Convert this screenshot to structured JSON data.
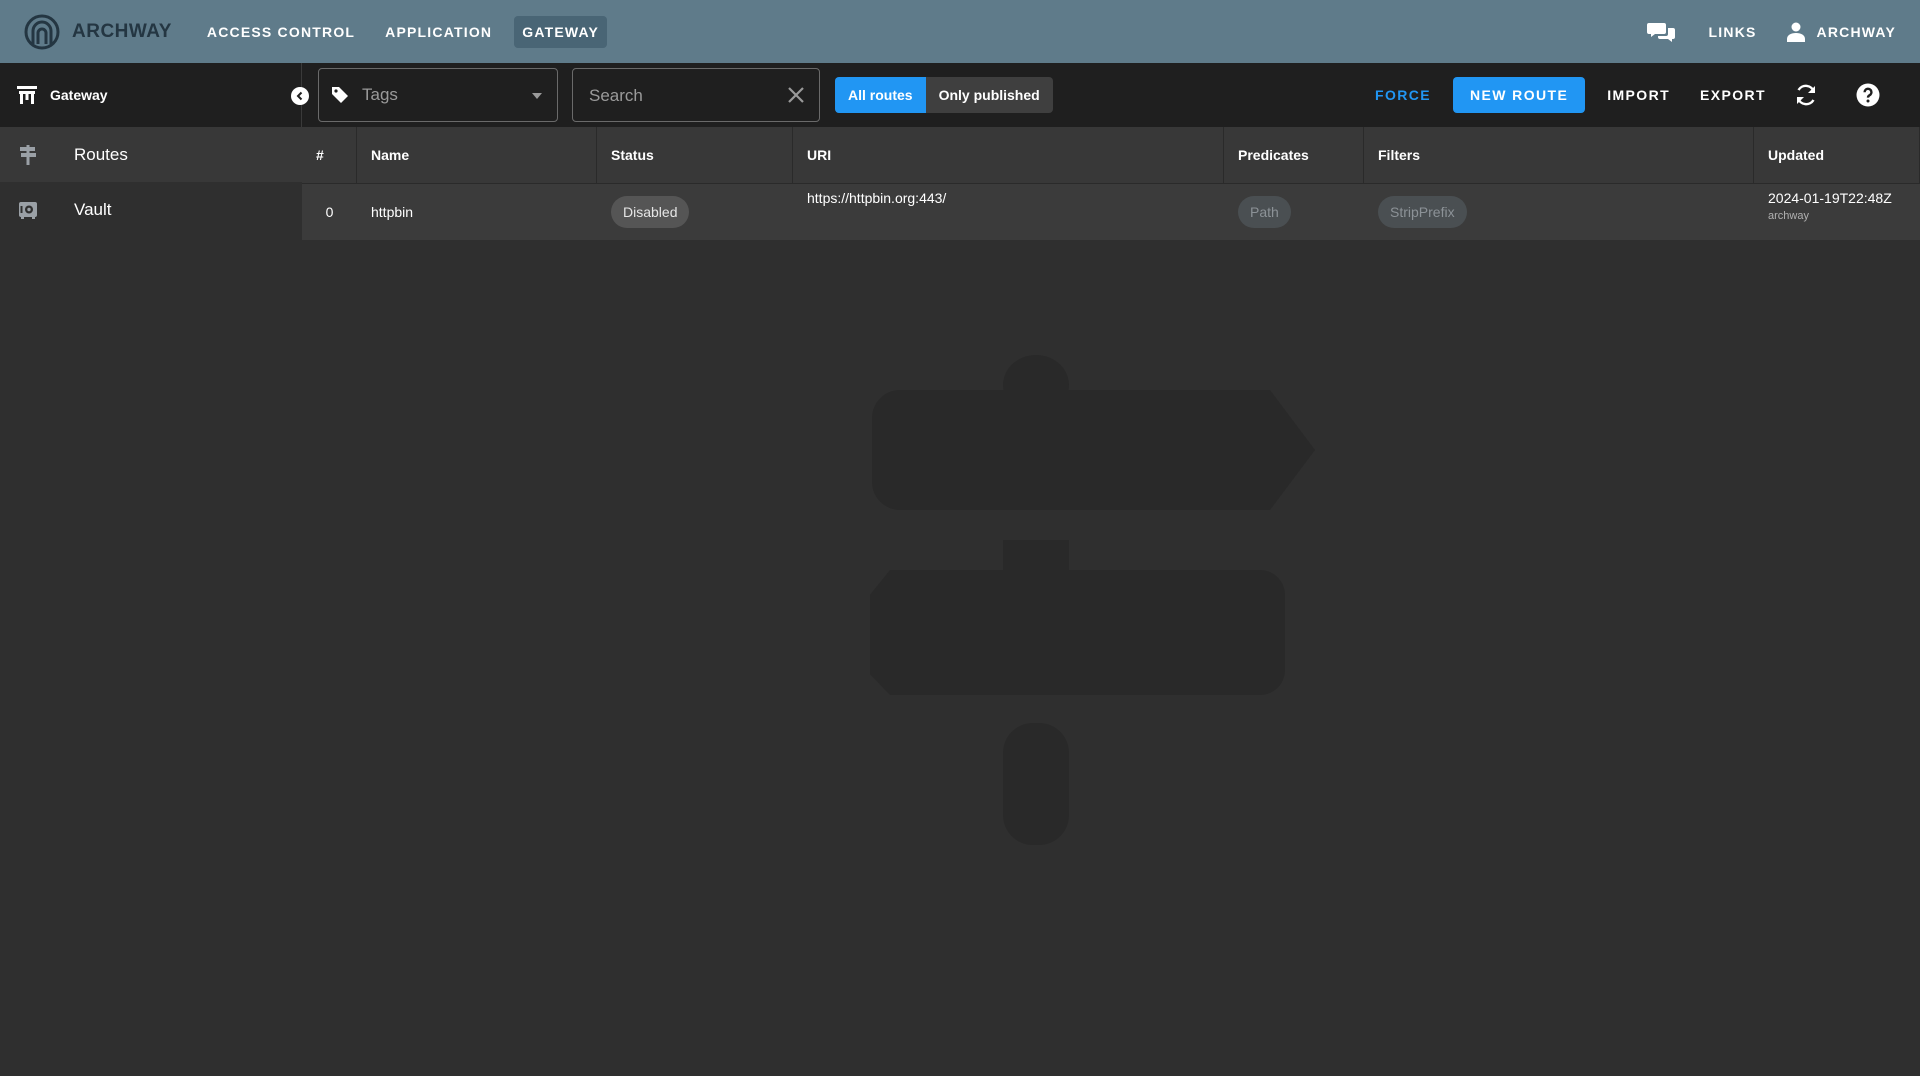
{
  "app": {
    "brand": "ARCHWAY",
    "nav": [
      "ACCESS CONTROL",
      "APPLICATION",
      "GATEWAY"
    ],
    "active_nav": "GATEWAY",
    "links_label": "LINKS",
    "user_label": "ARCHWAY"
  },
  "toolbar": {
    "section_title": "Gateway",
    "tags_placeholder": "Tags",
    "search_placeholder": "Search",
    "toggle": {
      "all": "All routes",
      "published": "Only published",
      "selected": "all"
    },
    "force_label": "FORCE",
    "new_route_label": "NEW ROUTE",
    "import_label": "IMPORT",
    "export_label": "EXPORT"
  },
  "sidebar": {
    "items": [
      {
        "label": "Routes",
        "icon": "signpost-icon",
        "selected": true
      },
      {
        "label": "Vault",
        "icon": "vault-icon",
        "selected": false
      }
    ]
  },
  "table": {
    "columns": [
      "#",
      "Name",
      "Status",
      "URI",
      "Predicates",
      "Filters",
      "Updated"
    ],
    "rows": [
      {
        "num": "0",
        "name": "httpbin",
        "status": "Disabled",
        "uri": "https://httpbin.org:443/",
        "predicates": "Path",
        "filters": "StripPrefix",
        "updated": "2024-01-19T22:48Z",
        "updated_by": "archway"
      }
    ]
  },
  "colors": {
    "topbar": "#5f7b8a",
    "toolbar": "#1f1f1f",
    "accent": "#2196f3",
    "background": "#2f2f2f"
  }
}
